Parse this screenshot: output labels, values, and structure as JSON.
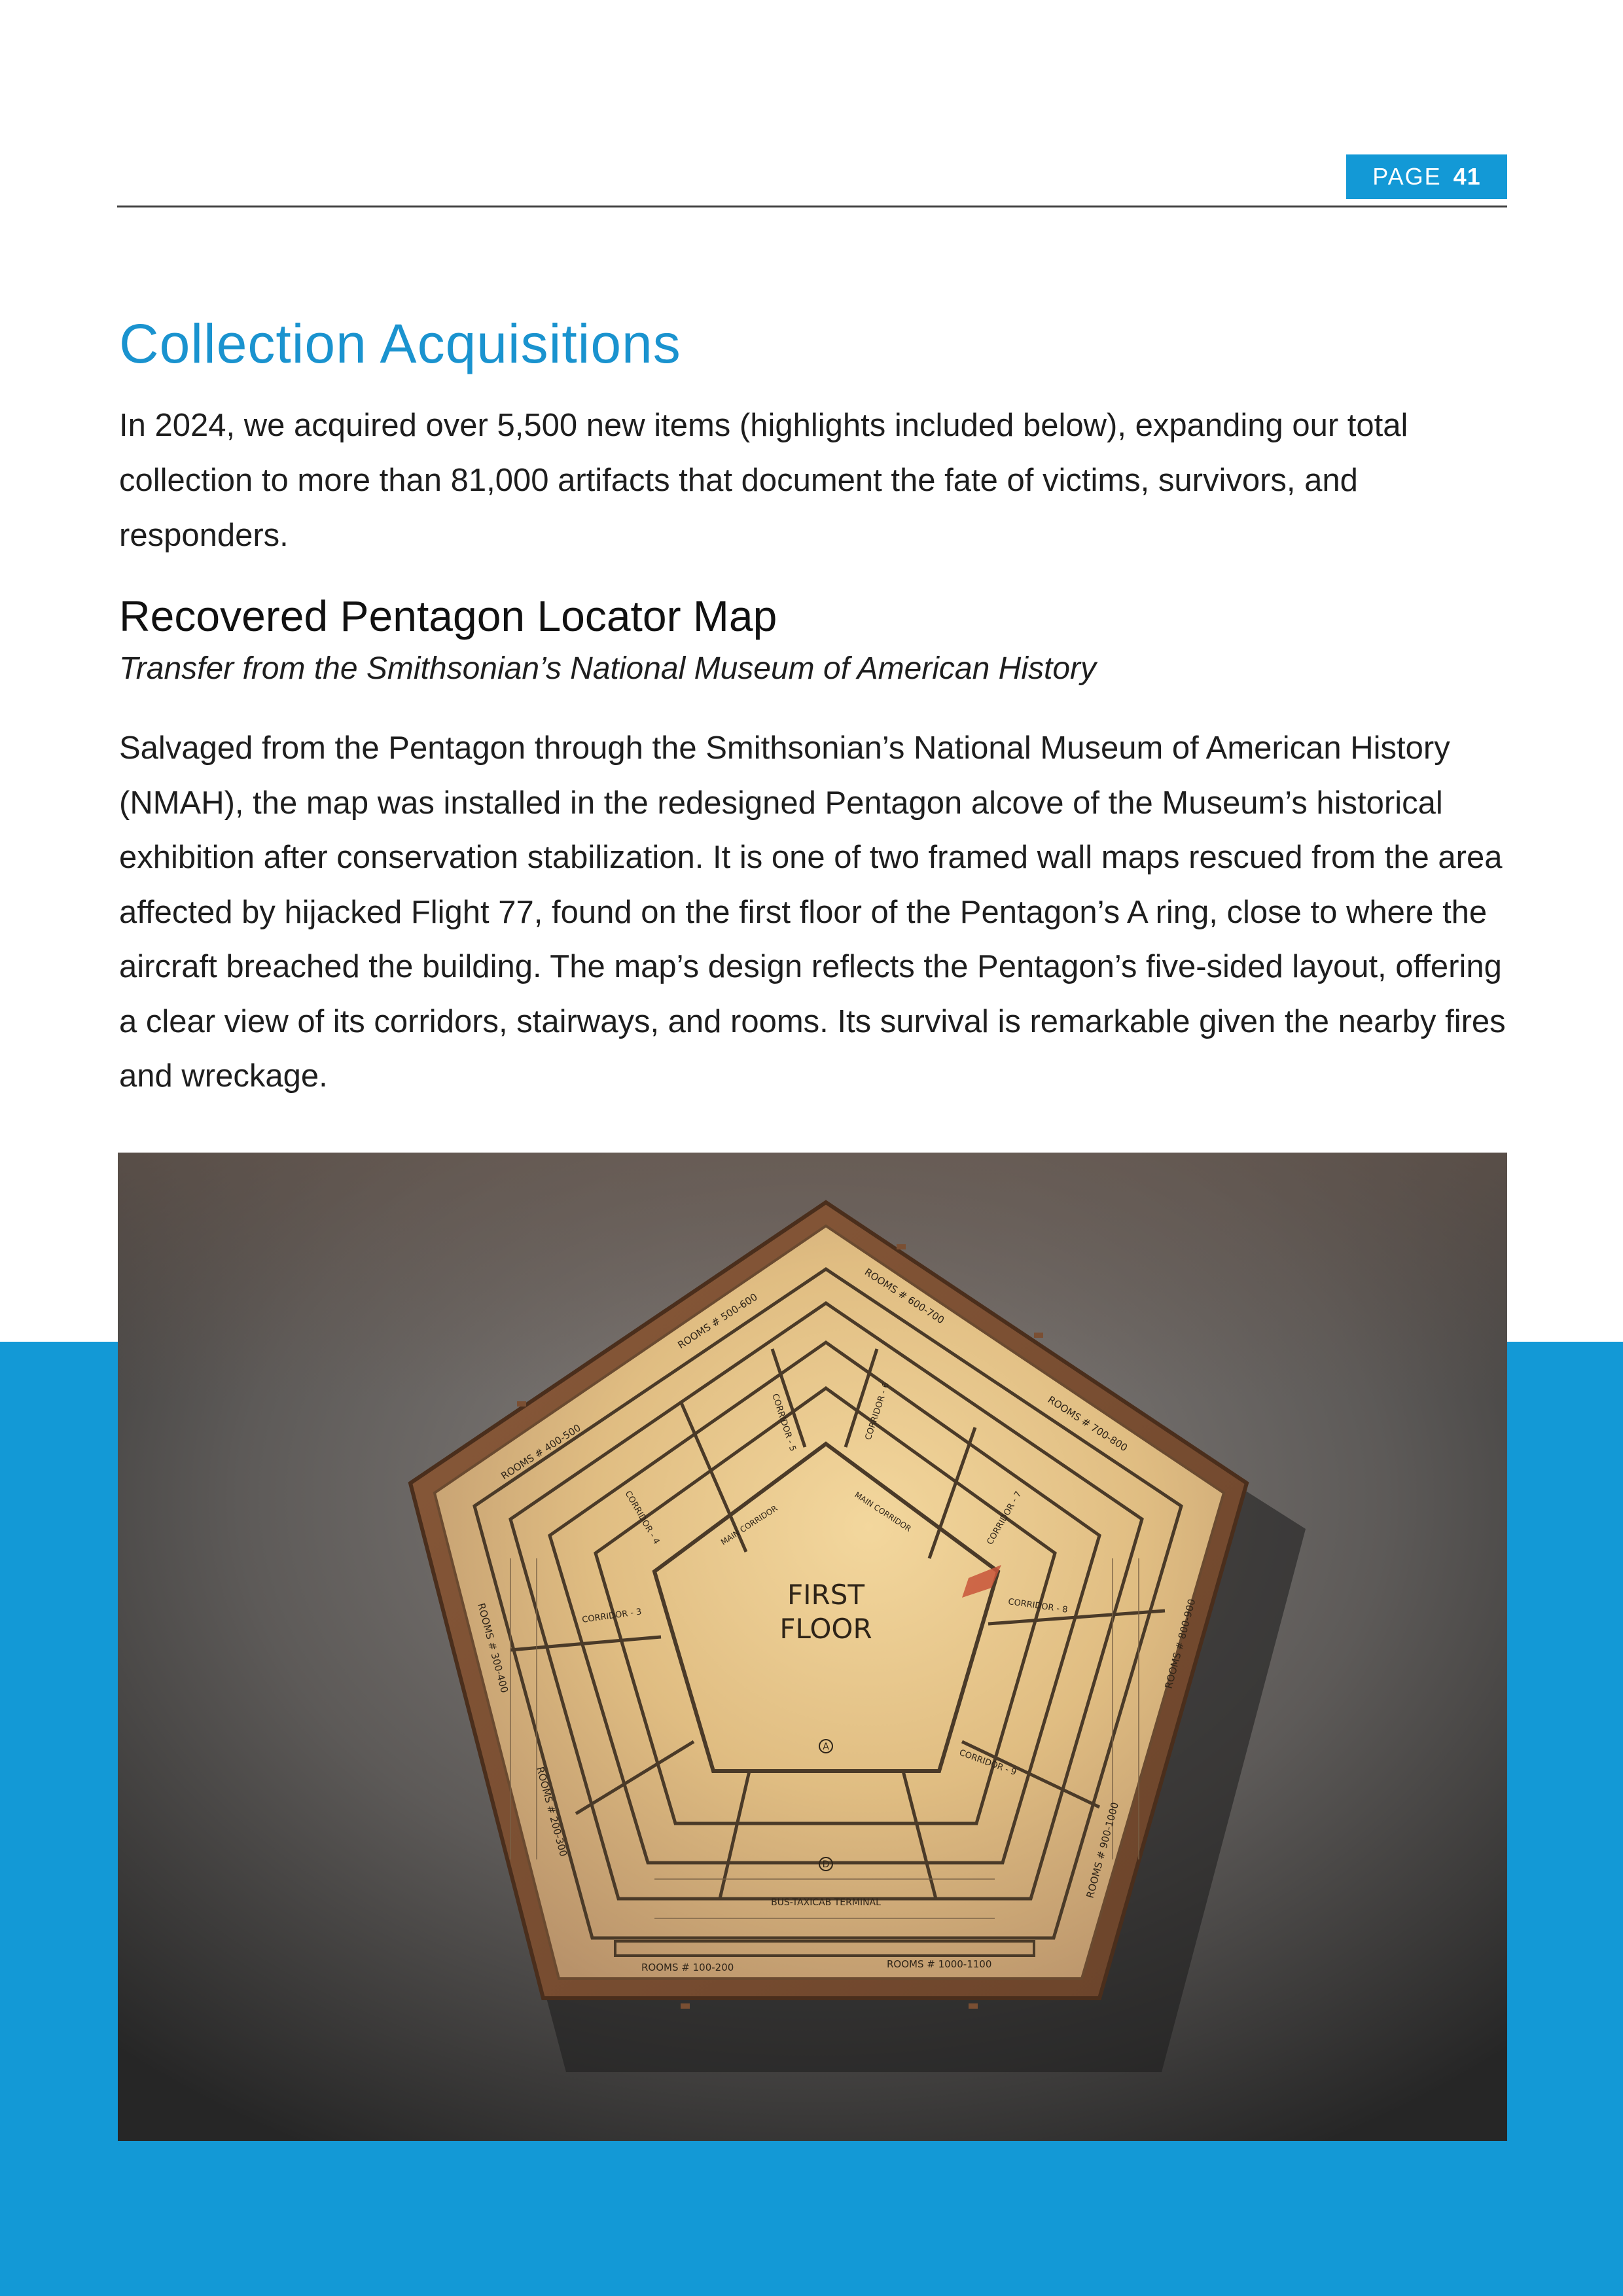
{
  "header": {
    "page_label": "PAGE",
    "page_number": "41"
  },
  "section": {
    "title": "Collection Acquisitions",
    "intro": "In 2024, we acquired over 5,500 new items (highlights included below), expanding our total collection to more than 81,000 artifacts that document the fate of victims, survivors, and responders."
  },
  "artifact": {
    "title": "Recovered Pentagon Locator Map",
    "subtitle": "Transfer from the Smithsonian’s National Museum of American History",
    "description": "Salvaged from the Pentagon through the Smithsonian’s National Museum of American History (NMAH), the map was installed in the redesigned Pentagon alcove of the Museum’s historical exhibition after conservation stabilization. It is one of two framed wall maps rescued from the area affected by hijacked Flight 77, found on the first floor of the Pentagon’s A ring, close to where the aircraft breached the building. The map’s design reflects the Pentagon’s five-sided layout, offering a clear view of its corridors, stairways, and rooms. Its survival is remarkable given the nearby fires and wreckage."
  },
  "map_photo": {
    "center_line1": "FIRST",
    "center_line2": "FLOOR",
    "labels": {
      "rooms_600_700": "ROOMS # 600-700",
      "rooms_500_600": "ROOMS # 500-600",
      "rooms_400_500": "ROOMS # 400-500",
      "rooms_700_800": "ROOMS # 700-800",
      "rooms_300_400": "ROOMS # 300-400",
      "rooms_800_900": "ROOMS # 800-900",
      "rooms_200_300": "ROOMS # 200-300",
      "rooms_900_1000": "ROOMS # 900-1000",
      "rooms_100_200": "ROOMS # 100-200",
      "rooms_1000_1100": "ROOMS # 1000-1100",
      "corridor_3": "CORRIDOR - 3",
      "corridor_4": "CORRIDOR - 4",
      "corridor_5": "CORRIDOR - 5",
      "corridor_6": "CORRIDOR - 6",
      "corridor_7": "CORRIDOR - 7",
      "corridor_8": "CORRIDOR - 8",
      "corridor_9": "CORRIDOR - 9",
      "main_corridor_left": "MAIN CORRIDOR",
      "main_corridor_right": "MAIN CORRIDOR",
      "bus_terminal": "BUS-TAXICAB TERMINAL",
      "ring_a": "A",
      "ring_d": "D"
    }
  },
  "colors": {
    "accent_blue": "#1399d6",
    "title_blue": "#1a93cf",
    "rule": "#3c3c3c"
  }
}
